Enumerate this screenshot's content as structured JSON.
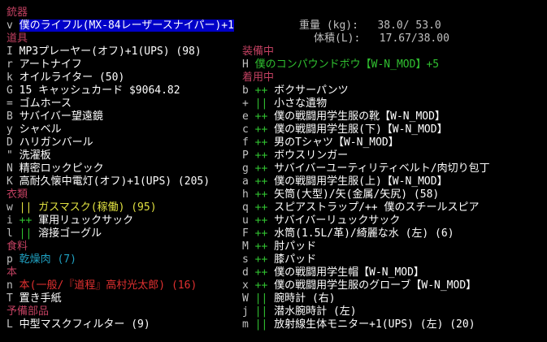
{
  "weapons": {
    "header": "銃器",
    "letter": "v",
    "name": "僕のライフル(MX-84レーザースナイパー)+1"
  },
  "stats": {
    "weight_label": "重量 (kg):",
    "weight_value": "38.0/ 53.0",
    "volume_label": "体積(L):",
    "volume_value": "17.67/38.00"
  },
  "tools": {
    "header": "道具",
    "items": [
      {
        "letter": "I",
        "name": "MP3プレーヤー(オフ)+1(UPS) (98)"
      },
      {
        "letter": "r",
        "name": "アートナイフ"
      },
      {
        "letter": "k",
        "name": "オイルライター (50)"
      },
      {
        "letter": "G",
        "name": "15 キャッシュカード $9064.82"
      },
      {
        "letter": "=",
        "name": "ゴムホース"
      },
      {
        "letter": "B",
        "name": "サバイバー望遠鏡"
      },
      {
        "letter": "y",
        "name": "シャベル"
      },
      {
        "letter": "D",
        "name": "ハリガンバール"
      },
      {
        "letter": "\"",
        "name": "洗濯板"
      },
      {
        "letter": "N",
        "name": "精密ロックピック"
      },
      {
        "letter": "K",
        "name": "高耐久懐中電灯(オフ)+1(UPS) (205)"
      }
    ]
  },
  "clothing": {
    "header": "衣類",
    "items": [
      {
        "letter": "w",
        "marker": "||",
        "name": "ガスマスク(稼働) (95)"
      },
      {
        "letter": "i",
        "marker": "++",
        "name": "軍用リュックサック"
      },
      {
        "letter": "l",
        "marker": "||",
        "name": "溶接ゴーグル"
      }
    ]
  },
  "food": {
    "header": "食料",
    "items": [
      {
        "letter": "p",
        "name": "乾燥肉 (7)"
      }
    ]
  },
  "books": {
    "header": "本",
    "items": [
      {
        "letter": "n",
        "name": "本(一般/『道程』高村光太郎) (16)"
      },
      {
        "letter": "T",
        "name": "置き手紙"
      }
    ]
  },
  "spare": {
    "header": "予備部品",
    "items": [
      {
        "letter": "L",
        "name": "中型マスクフィルター (9)"
      }
    ]
  },
  "wielded": {
    "header": "装備中",
    "letter": "H",
    "name": "僕のコンパウンドボウ【W-N_MOD】+5"
  },
  "worn": {
    "header": "着用中",
    "items": [
      {
        "letter": "b",
        "marker": "++",
        "name": "ボクサーパンツ"
      },
      {
        "letter": "+",
        "marker": "||",
        "name": "小さな遺物"
      },
      {
        "letter": "e",
        "marker": "++",
        "name": "僕の戦闘用学生服の靴【W-N_MOD】"
      },
      {
        "letter": "c",
        "marker": "++",
        "name": "僕の戦闘用学生服(下)【W-N_MOD】"
      },
      {
        "letter": "f",
        "marker": "++",
        "name": "男のTシャツ【W-N_MOD】"
      },
      {
        "letter": "P",
        "marker": "++",
        "name": "ボウスリンガー"
      },
      {
        "letter": "g",
        "marker": "++",
        "name": "サバイバーユーティリティベルト/肉切り包丁"
      },
      {
        "letter": "a",
        "marker": "++",
        "name": "僕の戦闘用学生服(上)【W-N_MOD】"
      },
      {
        "letter": "h",
        "marker": "++",
        "name": "矢筒(大型)/矢(金属/矢尻) (58)"
      },
      {
        "letter": "q",
        "marker": "++",
        "name": "スピアストラップ/++ 僕のスチールスピア"
      },
      {
        "letter": "u",
        "marker": "++",
        "name": "サバイバーリュックサック"
      },
      {
        "letter": "F",
        "marker": "++",
        "name": "水筒(1.5L/革)/綺麗な水 (左) (6)"
      },
      {
        "letter": "M",
        "marker": "++",
        "name": "肘パッド"
      },
      {
        "letter": "s",
        "marker": "++",
        "name": "膝パッド"
      },
      {
        "letter": "d",
        "marker": "++",
        "name": "僕の戦闘用学生帽【W-N_MOD】"
      },
      {
        "letter": "x",
        "marker": "++",
        "name": "僕の戦闘用学生服のグローブ【W-N_MOD】"
      },
      {
        "letter": "W",
        "marker": "||",
        "name": "腕時計 (右)"
      },
      {
        "letter": "j",
        "marker": "||",
        "name": "潜水腕時計 (左)"
      },
      {
        "letter": "m",
        "marker": "||",
        "name": "放射線生体モニター+1(UPS) (左) (20)"
      }
    ]
  }
}
